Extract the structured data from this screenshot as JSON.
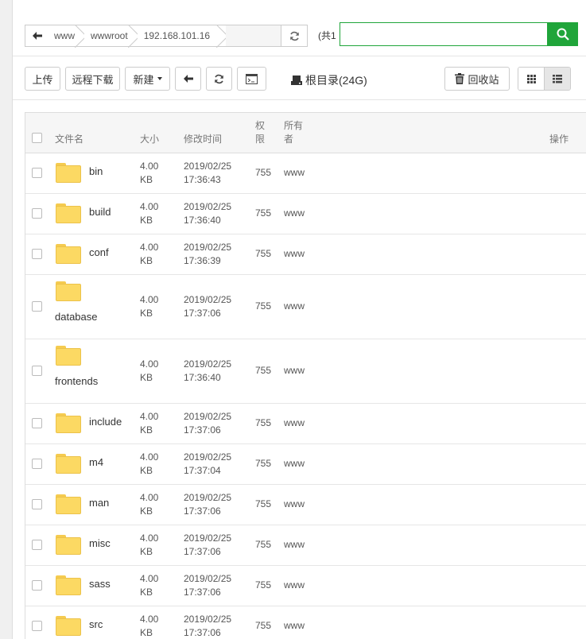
{
  "address_bar": {
    "crumbs": [
      "www",
      "wwwroot",
      "192.168.101.16"
    ],
    "total_text": "(共1"
  },
  "toolbar": {
    "upload": "上传",
    "remote_download": "远程下载",
    "new": "新建",
    "disk_label": "根目录(24G)",
    "recycle_bin": "回收站"
  },
  "table": {
    "headers": {
      "name": "文件名",
      "size": "大小",
      "mtime": "修改时间",
      "perm": "权限",
      "owner": "所有者",
      "actions": "操作"
    },
    "rows": [
      {
        "name": "bin",
        "size": "4.00 KB",
        "mtime": "2019/02/25 17:36:43",
        "perm": "755",
        "owner": "www"
      },
      {
        "name": "build",
        "size": "4.00 KB",
        "mtime": "2019/02/25 17:36:40",
        "perm": "755",
        "owner": "www"
      },
      {
        "name": "conf",
        "size": "4.00 KB",
        "mtime": "2019/02/25 17:36:39",
        "perm": "755",
        "owner": "www"
      },
      {
        "name": "database",
        "size": "4.00 KB",
        "mtime": "2019/02/25 17:37:06",
        "perm": "755",
        "owner": "www"
      },
      {
        "name": "frontends",
        "size": "4.00 KB",
        "mtime": "2019/02/25 17:36:40",
        "perm": "755",
        "owner": "www"
      },
      {
        "name": "include",
        "size": "4.00 KB",
        "mtime": "2019/02/25 17:37:06",
        "perm": "755",
        "owner": "www"
      },
      {
        "name": "m4",
        "size": "4.00 KB",
        "mtime": "2019/02/25 17:37:04",
        "perm": "755",
        "owner": "www"
      },
      {
        "name": "man",
        "size": "4.00 KB",
        "mtime": "2019/02/25 17:37:06",
        "perm": "755",
        "owner": "www"
      },
      {
        "name": "misc",
        "size": "4.00 KB",
        "mtime": "2019/02/25 17:37:06",
        "perm": "755",
        "owner": "www"
      },
      {
        "name": "sass",
        "size": "4.00 KB",
        "mtime": "2019/02/25 17:37:06",
        "perm": "755",
        "owner": "www"
      },
      {
        "name": "src",
        "size": "4.00 KB",
        "mtime": "2019/02/25 17:37:06",
        "perm": "755",
        "owner": "www"
      }
    ]
  },
  "colors": {
    "accent": "#20a53a",
    "folder": "#fcd963"
  },
  "icons": [
    "back-arrow-icon",
    "refresh-icon",
    "search-icon",
    "terminal-icon",
    "disk-icon",
    "trash-icon",
    "grid-view-icon",
    "list-view-icon",
    "folder-icon"
  ]
}
